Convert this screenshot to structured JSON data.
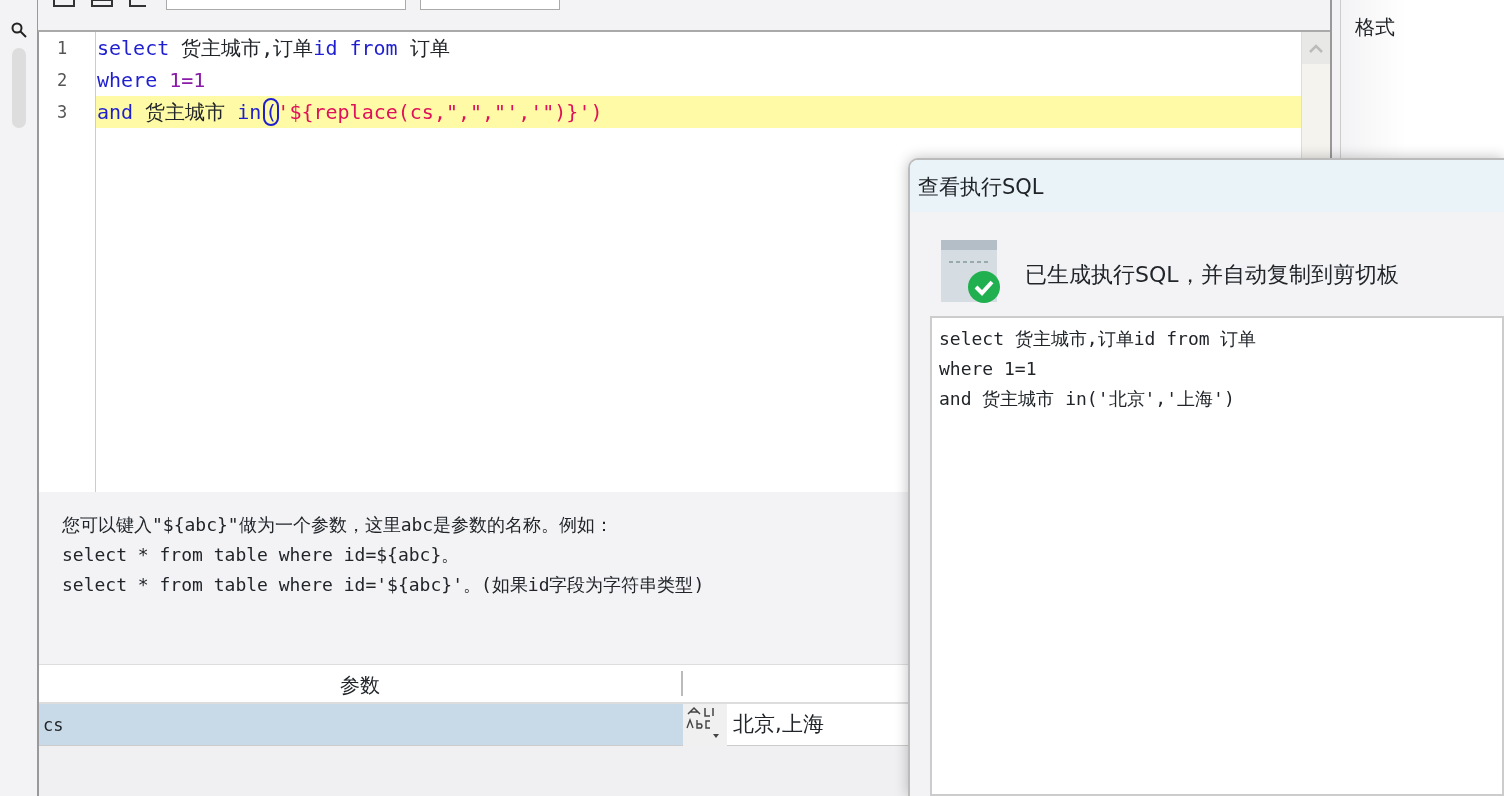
{
  "editor": {
    "lines": [
      {
        "number": "1",
        "highlighted": false,
        "tokens": [
          {
            "kind": "keyword",
            "text": "select"
          },
          {
            "kind": "plain",
            "text": " 货主城市,订单"
          },
          {
            "kind": "keyword",
            "text": "id"
          },
          {
            "kind": "keyword",
            "text": " from"
          },
          {
            "kind": "plain",
            "text": " 订单"
          }
        ]
      },
      {
        "number": "2",
        "highlighted": false,
        "tokens": [
          {
            "kind": "keyword",
            "text": "where"
          },
          {
            "kind": "number",
            "text": " 1=1"
          }
        ]
      },
      {
        "number": "3",
        "highlighted": true,
        "tokens": [
          {
            "kind": "keyword",
            "text": "and"
          },
          {
            "kind": "plain",
            "text": " 货主城市 "
          },
          {
            "kind": "keyword",
            "text": "in"
          },
          {
            "kind": "bracket",
            "text": "("
          },
          {
            "kind": "string",
            "text": "'${replace(cs,\",\",\"','\")}')"
          }
        ]
      }
    ]
  },
  "help_text": [
    "您可以键入\"${abc}\"做为一个参数，这里abc是参数的名称。例如：",
    "select * from table where id=${abc}。",
    "select * from table where id='${abc}'。(如果id字段为字符串类型)"
  ],
  "parameters": {
    "columns": [
      "参数"
    ],
    "rows": [
      {
        "name": "cs",
        "value": "北京,上海",
        "selected": true
      }
    ]
  },
  "side_panel": {
    "label": "格式"
  },
  "dialog": {
    "title": "查看执行SQL",
    "message": "已生成执行SQL，并自动复制到剪切板",
    "sql_lines": [
      "select 货主城市,订单id from 订单",
      "where 1=1",
      "and 货主城市 in('北京','上海')"
    ]
  }
}
